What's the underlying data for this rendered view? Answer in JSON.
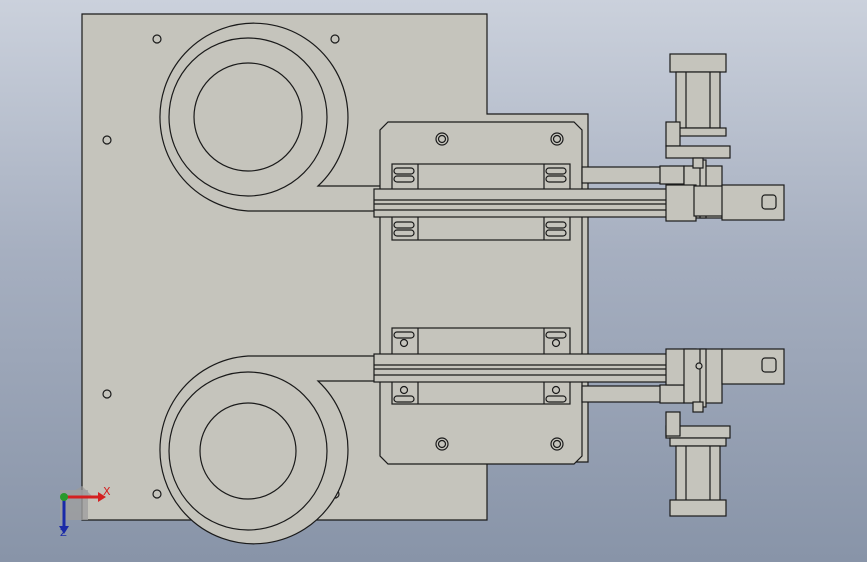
{
  "view": {
    "background_top": "#cbd1dc",
    "background_bottom": "#8894a8",
    "part_fill": "#c5c4bc",
    "edge_color": "#1a1a1a"
  },
  "triad": {
    "x_label": "X",
    "z_label": "Z",
    "x_color": "#d42020",
    "y_color": "#2a9a2a",
    "z_color": "#1a2aa8"
  }
}
